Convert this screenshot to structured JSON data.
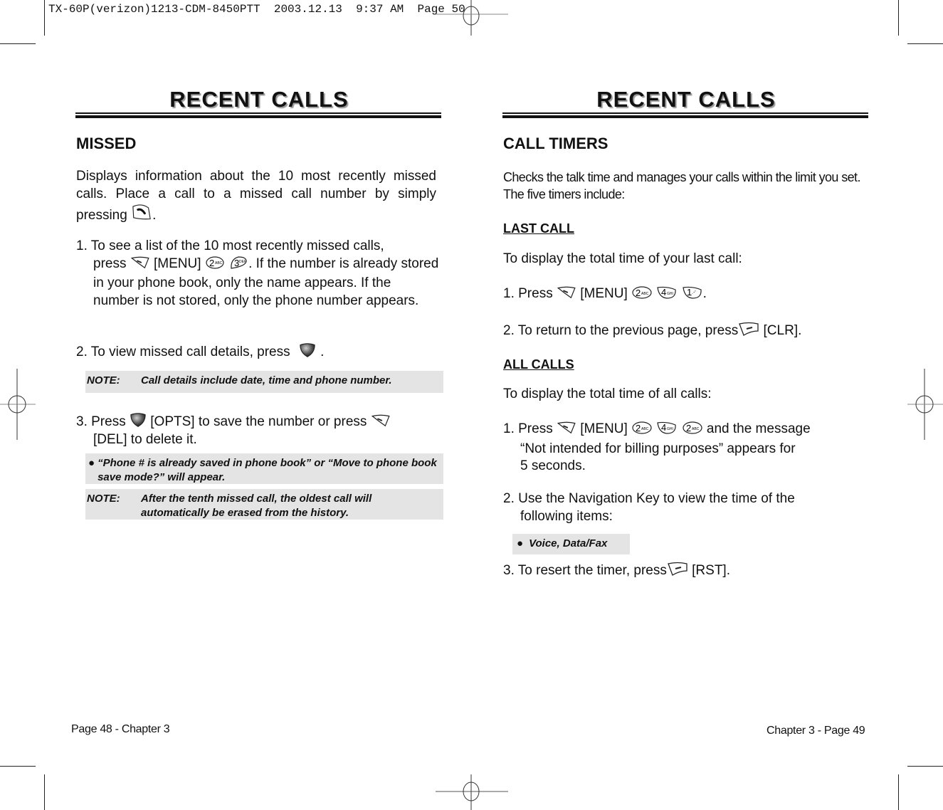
{
  "slug": "TX-60P(verizon)1213-CDM-8450PTT  2003.12.13  9:37 AM  Page 50",
  "left_page": {
    "title": "RECENT CALLS",
    "section_title": "MISSED",
    "intro_line1": "Displays information about the 10 most recently missed calls. Place a call to a missed call number by simply pressing",
    "intro_end": ".",
    "step1_a": "1. To see a list of the 10 most recently missed calls,",
    "step1_b": "press",
    "step1_menu": "[MENU]",
    "step1_c": ". If the number is already stored in your phone book, only the name appears. If the number is not stored, only the phone number appears.",
    "step2": "2. To view missed call details, press",
    "step2_end": ".",
    "note1_label": "NOTE:",
    "note1_text": "Call details include date, time and phone number.",
    "step3_a": "3. Press",
    "step3_b": "[OPTS] to save the number or press",
    "step3_c": "[DEL] to delete it.",
    "bullet_text": "“Phone # is already saved in phone book” or “Move to phone book save mode?” will appear.",
    "note2_label": "NOTE:",
    "note2_line1": "After the tenth missed call, the oldest call will",
    "note2_line2": "automatically be erased from the history.",
    "footer": "Page 48 - Chapter 3"
  },
  "right_page": {
    "title": "RECENT CALLS",
    "section_title": "CALL TIMERS",
    "intro": "Checks the talk time and manages your calls within the limit you set. The five timers include:",
    "last_call_heading": "LAST CALL",
    "last_call_desc": "To display the total time of your last call:",
    "lc_step1_a": "1. Press",
    "lc_step1_menu": "[MENU]",
    "lc_step1_end": ".",
    "lc_step2_a": "2. To return to the previous page, press",
    "lc_step2_b": "[CLR].",
    "all_calls_heading": "ALL CALLS",
    "all_calls_desc": "To display the total time of all calls:",
    "ac_step1_a": "1. Press",
    "ac_step1_menu": "[MENU]",
    "ac_step1_b": "and the message",
    "ac_step1_c": "“Not intended for billing purposes” appears for",
    "ac_step1_d": "5 seconds.",
    "ac_step2_a": "2. Use the Navigation Key to view the time of the",
    "ac_step2_b": "following items:",
    "bullet_items": "Voice, Data/Fax",
    "ac_step3_a": "3. To resert the timer, press",
    "ac_step3_b": "[RST].",
    "footer": "Chapter 3 - Page 49"
  },
  "keys": {
    "k2": {
      "num": "2",
      "sub": "ABC"
    },
    "k3": {
      "num": "3",
      "sub": "DEF"
    },
    "k4": {
      "num": "4",
      "sub": "GHI"
    },
    "k1": {
      "num": "1",
      "sub": ".-'"
    }
  },
  "icons": [
    "send-key-icon",
    "left-soft-key-icon",
    "right-soft-key-icon",
    "ok-key-icon",
    "bullet-icon",
    "registration-mark-icon",
    "crop-mark-icon"
  ]
}
